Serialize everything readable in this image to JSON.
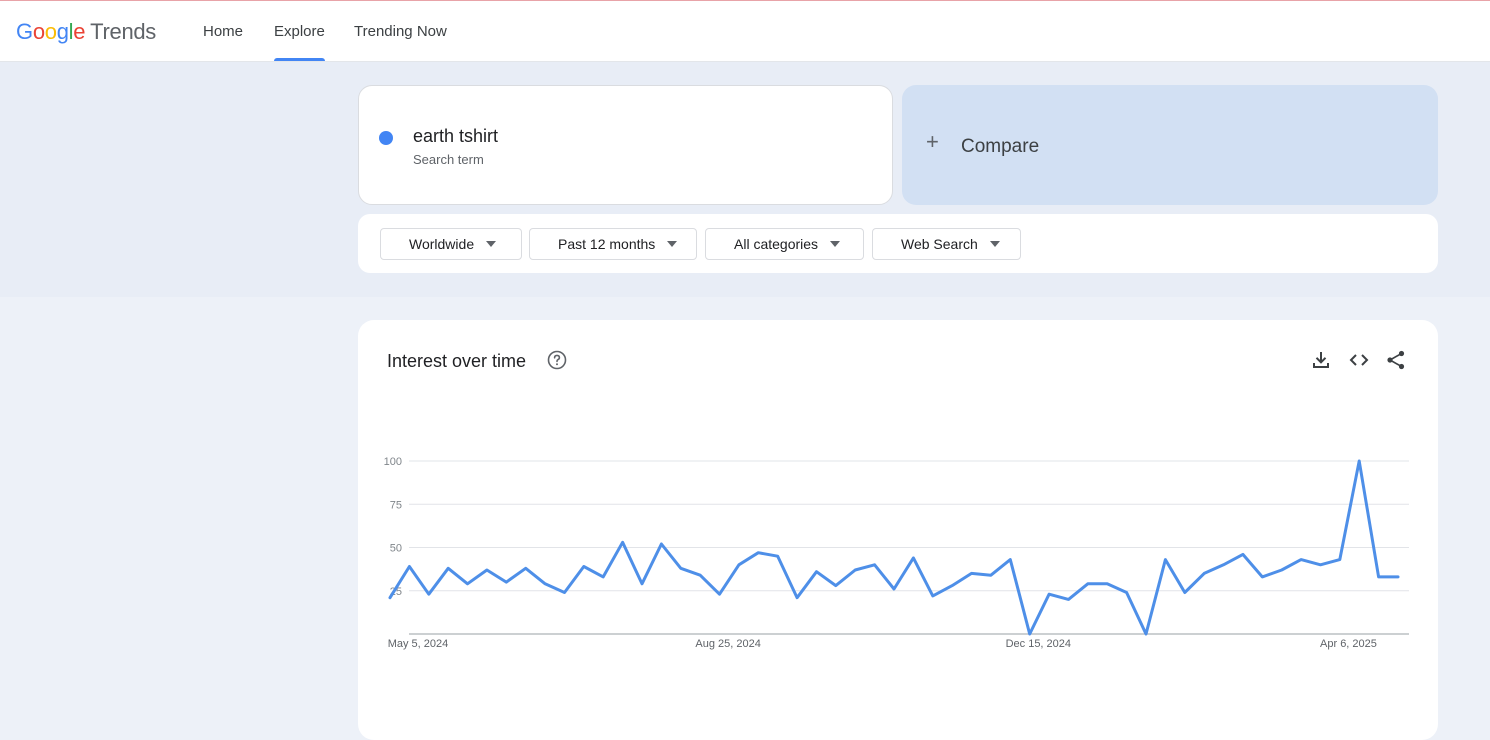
{
  "header": {
    "logo": {
      "g1": "G",
      "o1": "o",
      "o2": "o",
      "g2": "g",
      "l": "l",
      "e": "e",
      "product": "Trends"
    },
    "nav": [
      {
        "label": "Home",
        "active": false
      },
      {
        "label": "Explore",
        "active": true
      },
      {
        "label": "Trending Now",
        "active": false
      }
    ]
  },
  "search_term": {
    "name": "earth tshirt",
    "type": "Search term",
    "color": "#4285f4"
  },
  "compare": {
    "label": "Compare",
    "icon": "plus-icon"
  },
  "filters": [
    {
      "label": "Worldwide"
    },
    {
      "label": "Past 12 months"
    },
    {
      "label": "All categories"
    },
    {
      "label": "Web Search"
    }
  ],
  "interest_over_time": {
    "title": "Interest over time",
    "actions": [
      "download-icon",
      "embed-code-icon",
      "share-icon"
    ]
  },
  "chart_data": {
    "type": "line",
    "title": "",
    "series": [
      {
        "color": "#4e8fe8",
        "values": [
          21,
          39,
          23,
          38,
          29,
          37,
          30,
          38,
          29,
          24,
          39,
          33,
          53,
          29,
          52,
          38,
          34,
          23,
          40,
          47,
          45,
          21,
          36,
          28,
          37,
          40,
          26,
          44,
          22,
          28,
          35,
          34,
          43,
          0,
          23,
          20,
          29,
          29,
          24,
          0,
          43,
          24,
          35,
          40,
          46,
          33,
          37,
          43,
          40,
          43,
          100,
          33,
          33
        ]
      }
    ],
    "x_tick_labels": [
      "May 5, 2024",
      "Aug 25, 2024",
      "Dec 15, 2024",
      "Apr 6, 2025"
    ],
    "x_tick_index": [
      0,
      16,
      32,
      48
    ],
    "y_ticks": [
      25,
      50,
      75,
      100
    ],
    "ylim": [
      0,
      100
    ],
    "grid": true
  }
}
